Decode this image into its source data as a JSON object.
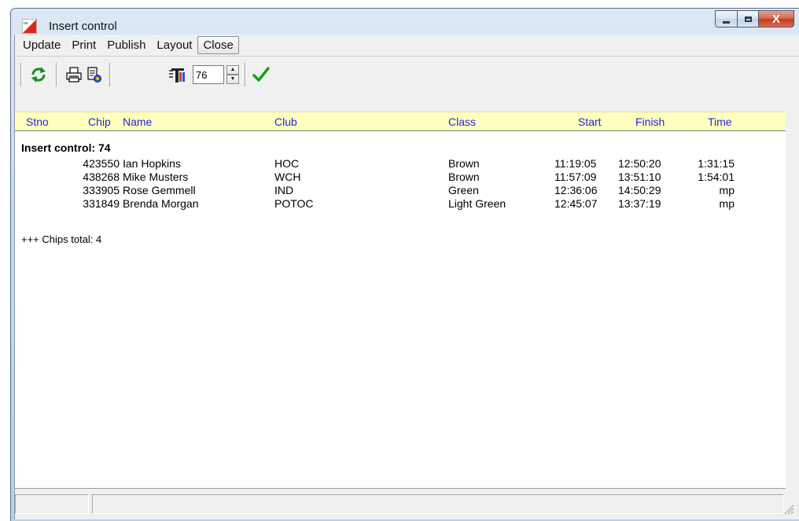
{
  "window": {
    "title": "Insert control",
    "minimize_label": "",
    "maximize_label": "",
    "close_label": "X"
  },
  "menu": [
    "Update",
    "Print",
    "Publish",
    "Layout",
    "Close"
  ],
  "toolbar": {
    "control_number_value": "76"
  },
  "table": {
    "headers": {
      "stno": "Stno",
      "chip": "Chip",
      "name": "Name",
      "club": "Club",
      "class": "Class",
      "start": "Start",
      "finish": "Finish",
      "time": "Time"
    },
    "section_title": "Insert control: 74",
    "rows": [
      {
        "chip": "423550",
        "name": "Ian Hopkins",
        "club": "HOC",
        "class": "Brown",
        "start": "11:19:05",
        "finish": "12:50:20",
        "time": "1:31:15"
      },
      {
        "chip": "438268",
        "name": "Mike Musters",
        "club": "WCH",
        "class": "Brown",
        "start": "11:57:09",
        "finish": "13:51:10",
        "time": "1:54:01"
      },
      {
        "chip": "333905",
        "name": "Rose Gemmell",
        "club": "IND",
        "class": "Green",
        "start": "12:36:06",
        "finish": "14:50:29",
        "time": "mp"
      },
      {
        "chip": "331849",
        "name": "Brenda Morgan",
        "club": "POTOC",
        "class": "Light Green",
        "start": "12:45:07",
        "finish": "13:37:19",
        "time": "mp"
      }
    ],
    "footer": "+++ Chips total: 4"
  },
  "colors": {
    "header_bg": "#ffffc0",
    "header_text": "#1a2adf",
    "ok_check": "#1e9a1e",
    "refresh_icon": "#1f8a1f"
  },
  "icons": [
    "orienteering-flag-icon",
    "refresh-icon",
    "printer-icon",
    "print-preview-icon",
    "control-punch-icon",
    "checkmark-icon"
  ]
}
